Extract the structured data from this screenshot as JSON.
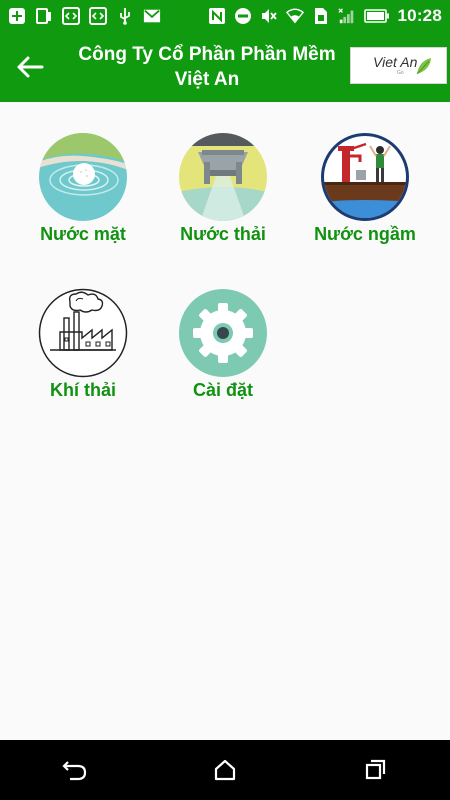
{
  "status_bar": {
    "time": "10:28",
    "icons": [
      "add-box-icon",
      "tablet-icon",
      "code-icon",
      "code-icon",
      "usb-icon",
      "gmail-icon",
      "nfc-icon",
      "do-not-disturb-icon",
      "mute-icon",
      "wifi-icon",
      "sim-icon",
      "signal-icon",
      "battery-icon"
    ]
  },
  "app_bar": {
    "title": "Công Ty Cổ Phần Phần Mềm Việt An",
    "logo_text": "Viet An",
    "logo_sub": "Go"
  },
  "menu": {
    "items": [
      {
        "label": "Nước mặt",
        "icon": "surface-water-icon"
      },
      {
        "label": "Nước thải",
        "icon": "wastewater-icon"
      },
      {
        "label": "Nước ngầm",
        "icon": "groundwater-icon"
      },
      {
        "label": "Khí thải",
        "icon": "factory-emission-icon"
      },
      {
        "label": "Cài đặt",
        "icon": "settings-gear-icon"
      }
    ]
  },
  "nav_bar": {
    "buttons": [
      "back-nav-icon",
      "home-icon",
      "recents-icon"
    ]
  },
  "colors": {
    "primary_green": "#0f9a0f",
    "label_green": "#119211",
    "background": "#fafafa",
    "nav_bar": "#000000"
  }
}
